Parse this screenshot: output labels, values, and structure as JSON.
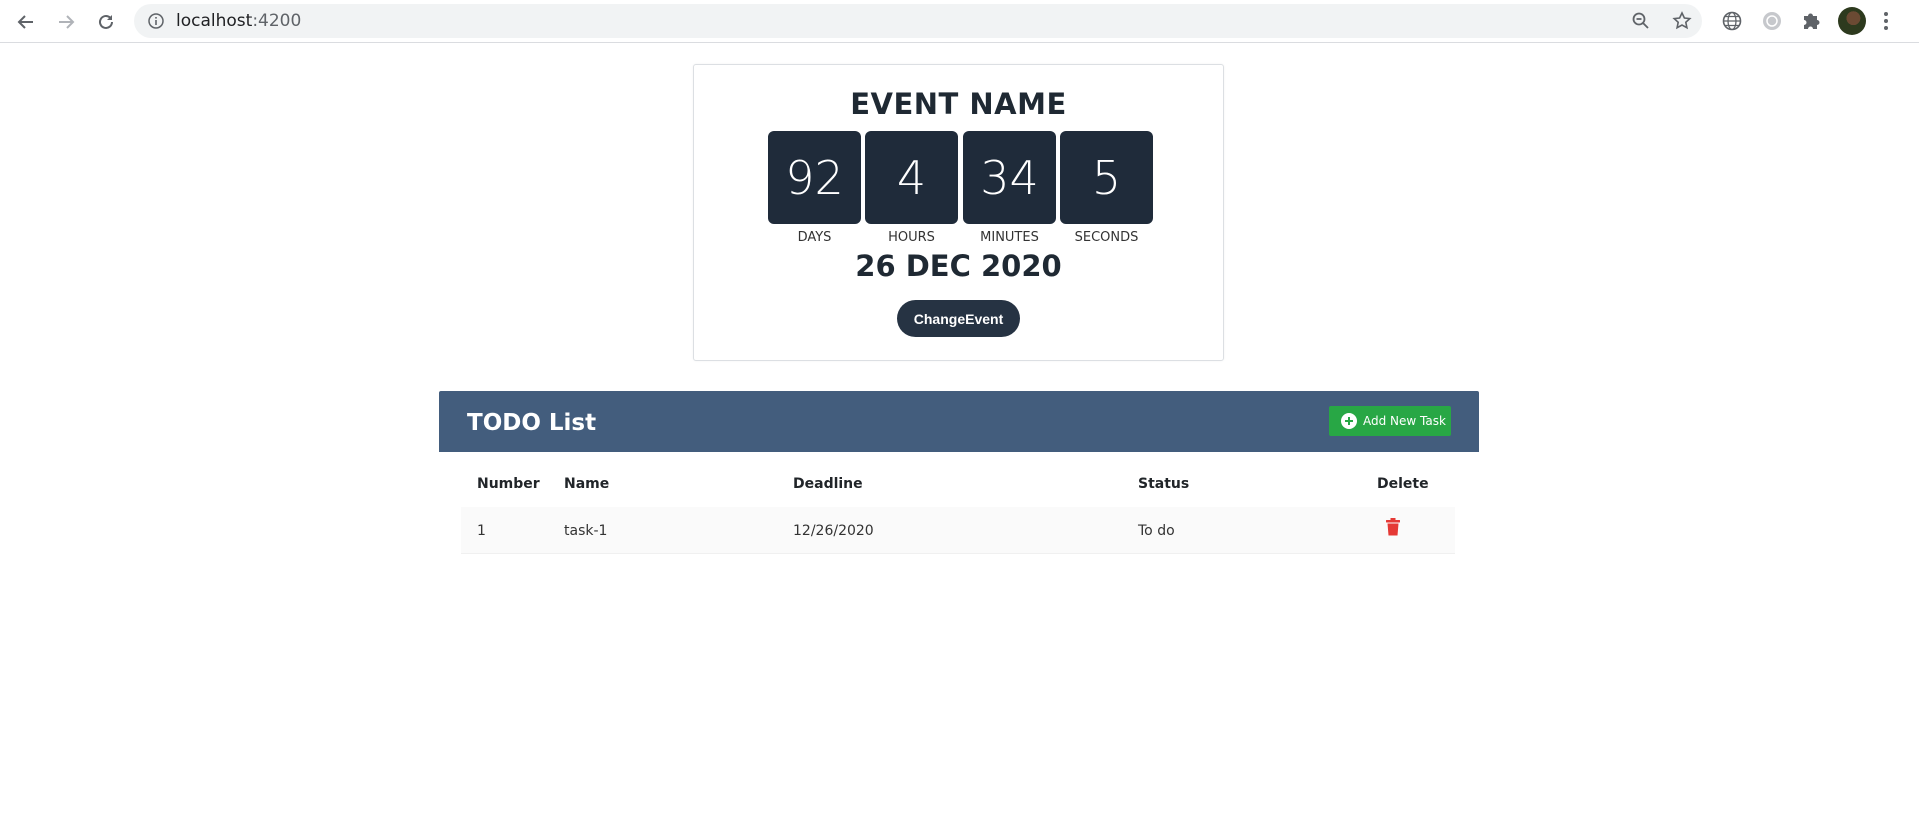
{
  "browser": {
    "url_host": "localhost",
    "url_port": ":4200"
  },
  "countdown": {
    "event_name": "EVENT NAME",
    "tiles": [
      {
        "value": "92",
        "unit": "DAYS"
      },
      {
        "value": "4",
        "unit": "HOURS"
      },
      {
        "value": "34",
        "unit": "MINUTES"
      },
      {
        "value": "5",
        "unit": "SECONDS"
      }
    ],
    "date": "26 DEC 2020",
    "change_label": "ChangeEvent"
  },
  "todo": {
    "title": "TODO List",
    "add_label": "Add New Task",
    "columns": [
      "Number",
      "Name",
      "Deadline",
      "Status",
      "Delete"
    ],
    "rows": [
      {
        "number": "1",
        "name": "task-1",
        "deadline": "12/26/2020",
        "status": "To do"
      }
    ]
  },
  "colors": {
    "header_bg": "#435d7d",
    "tile_bg": "#1f2b3a",
    "add_button": "#28a745",
    "delete_icon": "#e53935"
  }
}
